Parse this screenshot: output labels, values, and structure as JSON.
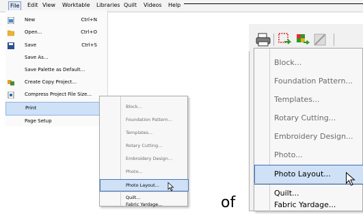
{
  "menubar": {
    "items": [
      "File",
      "Edit",
      "View",
      "Worktable",
      "Libraries",
      "Quilt",
      "Videos",
      "Help"
    ]
  },
  "file_menu": {
    "new": {
      "label": "New",
      "shortcut": "Ctrl+N"
    },
    "open": {
      "label": "Open...",
      "shortcut": "Ctrl+O"
    },
    "save": {
      "label": "Save",
      "shortcut": "Ctrl+S"
    },
    "save_as": {
      "label": "Save As..."
    },
    "save_palette": {
      "label": "Save Palette as Default..."
    },
    "create_copy": {
      "label": "Create Copy Project..."
    },
    "compress": {
      "label": "Compress Project File Size..."
    },
    "print": {
      "label": "Print"
    },
    "page_setup": {
      "label": "Page Setup"
    }
  },
  "print_submenu": {
    "items": [
      "Block...",
      "Foundation Pattern...",
      "Templates...",
      "Rotary Cutting...",
      "Embroidery Design...",
      "Photo...",
      "Photo Layout...",
      "Quilt...",
      "Fabric Yardage..."
    ]
  },
  "caption": {
    "text": "of"
  },
  "zoom_submenu": {
    "items": [
      "Block...",
      "Foundation Pattern...",
      "Templates...",
      "Rotary Cutting...",
      "Embroidery Design...",
      "Photo...",
      "Photo Layout...",
      "Quilt...",
      "Fabric Yardage..."
    ]
  },
  "colors": {
    "highlight": "#cfe1f7",
    "highlight_border": "#3d6db1",
    "disabled_text": "#6d6d6d"
  },
  "icons": [
    "new-doc-icon",
    "open-folder-icon",
    "save-disk-icon",
    "copy-project-icon",
    "compress-icon",
    "print-icon",
    "block-select-icon",
    "quilt-grid-icon",
    "ruler-icon",
    "mouse-cursor-icon"
  ]
}
